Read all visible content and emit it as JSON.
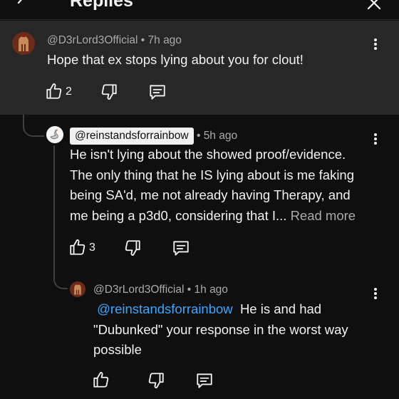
{
  "header": {
    "title": "Replies",
    "back_icon": "back-arrow-icon",
    "close_icon": "close-icon"
  },
  "comments": [
    {
      "handle": "@D3rLord3Official",
      "separator": "•",
      "time": "7h ago",
      "text": "Hope that ex stops lying about you for clout!",
      "likes": "2"
    },
    {
      "handle": "@reinstandsforrainbow",
      "separator": "•",
      "time": "5h ago",
      "lines": [
        "He isn't lying about the showed proof/evidence.",
        "The only thing that he IS lying about is me faking",
        "being SA'd, me not already having Therapy, and",
        "me being a p3d0, considering that I..."
      ],
      "read_more": "Read more",
      "likes": "3"
    },
    {
      "handle": "@D3rLord3Official",
      "separator": "•",
      "time": "1h ago",
      "mention": "@reinstandsforrainbow",
      "lines": [
        "He is and had",
        "\"Dubunked\" your response in the worst way",
        "possible"
      ]
    }
  ],
  "colors": {
    "background": "#0f0f0f",
    "highlight": "#272727",
    "link": "#3ea6ff",
    "muted": "#aaaaaa"
  }
}
